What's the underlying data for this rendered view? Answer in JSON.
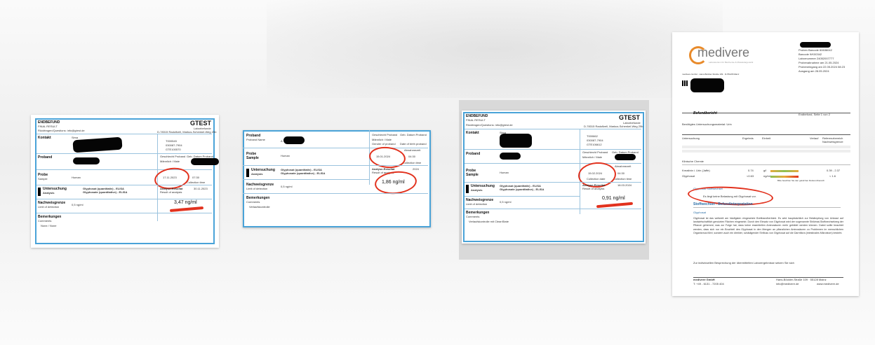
{
  "doc1": {
    "title": "ENDBEFUND",
    "subtitle": "FINAL RESULT",
    "brand": "GTEST",
    "brand_sub": "Laborbefunde",
    "email": "Rückfragen/Questions: info@gtest.de",
    "address": "D-78315 Radolfzell, Markus-Schenkel-Weg 25b",
    "kontakt": "Kontakt",
    "kontakt_name": "Sima",
    "ids": [
      "T000545",
      "030087-7904",
      "GTE100570"
    ],
    "proband": "Proband",
    "geschlecht_label": "Geschlecht Proband",
    "geschlecht": "Männlich / Male",
    "geburt_label": "Geb. Datum Proband",
    "probe": "Probe",
    "sample": "Sample",
    "human": "Human",
    "date1": "17.11.2023",
    "time1": "07:30",
    "collection_time": "Collection time",
    "untersuchung": "Untersuchung",
    "analysis": "Analysis",
    "test1": "Glyphosat (quantitativ) - ELISA",
    "test2": "Glyphosate (quantitative) - ELISA",
    "analyse_resultat": "Analyse-Resultat",
    "result_of_analysis": "Result of analysis",
    "result_date": "30.11.2023",
    "result_value": "3,47 ng/ml",
    "nachweisgrenze": "Nachweisgrenze",
    "limit": "Limit of detection",
    "limit_value": "0,5 ng/ml",
    "bemerkungen": "Bemerkungen",
    "comments": "Comments",
    "remark": "None / None"
  },
  "doc2": {
    "proband": "Proband",
    "proband_sub": "Proband Name",
    "proband_initial": "A",
    "probe": "Probe",
    "sample": "Sample",
    "human": "Human",
    "geschlecht_label": "Geschlecht Proband",
    "geschlecht": "Männlich / Male",
    "gender_label": "Gender of proband",
    "geburt_label": "Geb. Datum Proband",
    "date_label": "Date of birth proband",
    "date": "15.01.2024",
    "time": "04:30",
    "abnahmezeit": "Abnahmezeit",
    "collection_time": "Collection time",
    "untersuchung": "Untersuchung",
    "analysis": "Analysis",
    "test1": "Glyphosat (quantitativ) - ELISA",
    "test2": "Glyphosate (quantitative) - ELISA",
    "analyse_resultat": "Analyse-Resultat",
    "result_of_analysis": "Result of analysis",
    "result_date": "2024",
    "result_value": "1,86 ng/ml",
    "nachweisgrenze": "Nachweisgrenze",
    "limit": "Limit of detection",
    "limit_value": "0,5 ng/ml",
    "bemerkungen": "Bemerkungen",
    "comments": "Comments",
    "remark": "Verlaufskontrolle"
  },
  "doc3": {
    "title": "ENDBEFUND",
    "subtitle": "FINAL RESULT",
    "brand": "GTEST",
    "brand_sub": "Laborbefunde",
    "email": "Rückfragen/Questions: info@gtest.de",
    "address": "D-78315 Radolfzell, Markus-Schenkel-Weg 25b",
    "kontakt": "Kontakt",
    "kontakt_name": "Sima",
    "ids": [
      "T000662",
      "030087-7904",
      "GTE106612"
    ],
    "proband": "Proband",
    "geschlecht_label": "Geschlecht Proband",
    "geschlecht": "Männlich / Male",
    "geburt_label": "Geb. Datum Proband",
    "probe": "Probe",
    "sample": "Sample",
    "human": "Human",
    "abnahmezeit": "Abnahmezeit",
    "date": "15.02.2024",
    "time": "04:30",
    "collection_date": "Collection date",
    "collection_time": "Collection time",
    "untersuchung": "Untersuchung",
    "analysis": "Analysis",
    "test1": "Glyphosat (quantitativ) - ELISA",
    "test2": "Glyphosate (quantitative) - ELISA",
    "analyse_resultat": "Analyse-Resultat",
    "result_of_analysis": "Result of analysis",
    "result_date": "18.03.2024",
    "result_value": "0,91 ng/ml",
    "nachweisgrenze": "Nachweisgrenze",
    "limit": "Limit of detection",
    "limit_value": "0,5 ng/ml",
    "bemerkungen": "Bemerkungen",
    "comments": "Comments",
    "remark": "Verlaufskontrolle mit CleanState"
  },
  "doc4": {
    "logo": "medivere",
    "logo_sub": "Laboratorium für Biochemie & Molekulargenetik",
    "sender": "medivere GmbH · Hans-Böckler-Straße 109 · D-55128 Mainz",
    "info_lines": [
      "Proben Barcode 60636042",
      "Barcode 9/K00342",
      "Labornummer 24052007777",
      "Probenabnahme am 21.05.2024",
      "Probeneingang am 22.05.2024 08:23",
      "Ausgang am 28.05.2024"
    ],
    "befundbericht": "Befundbericht",
    "endbefund": "Endbefund, Seite 1 von 2",
    "material": "Benötigtes Untersuchungsmaterial: Urin",
    "col_untersuchung": "Untersuchung",
    "col_ergebnis": "Ergebnis",
    "col_einheit": "Einheit",
    "col_verlauf": "Verlauf",
    "col_referenz": "Referenzbereich",
    "col_nachweis": "Nachweisgrenze",
    "section_klinische": "Klinische Chemie",
    "row1_name": "Kreatinin i. Urin (Jaffe)",
    "row1_value": "0.74",
    "row1_unit": "g/l",
    "row1_ref": "0.39 - 2.37",
    "row2_name": "Glyphosat",
    "row2_value": "<0.63",
    "row2_unit": "ng/ml",
    "row2_ref": "< 1.6",
    "note": "Bitte beachten Sie den gekürzten Referenzbereich",
    "stoffwechsel": "Glyphosat Stoffwechsel",
    "circled_text": "Es liegt keine Belastung mit Glyphosat vor.",
    "section2": "Stoffwechsel - Befundinterpretation",
    "glyphosat_heading": "Glyphosat",
    "paragraph": "Glyphosat ist das weltweit am häufigsten eingesetzte Breitbandherbizid. Es wird hauptsächlich zur Bekämpfung von Unkraut auf landwirtschaftlich genutzten Flächen eingesetzt. Durch den Einsatz von Glyphosat wird der sogenannte Shikimat-Stoffwechselweg der Pflanze gehemmt, was zur Folge hat, dass keine essentiellen Aminosäuren mehr gebildet werden können. Dabei sollte beachtet werden, dass sich nur ein Bruchteil des Glyphosat in den Mengen an pflanzlichen Aminosäuren zu Problemen im menschlichen Organismus führt, sondern auch ein direkter, schädigender Einfluss von Glyphosat auf die Darmflora (intestinales Mikrobiom) besteht.",
    "closing": "Zur individuellen Besprechung der übermittelten Laborergebnisse setzen Sie sich",
    "footer_company": "medivere GmbH",
    "footer_address": "Hans-Böckler-Straße 109 · 55128 Mainz",
    "footer_phone": "T: +49 - 6131 - 7205 404",
    "footer_email": "info@medivere.de",
    "footer_web": "www.medivere.de"
  }
}
